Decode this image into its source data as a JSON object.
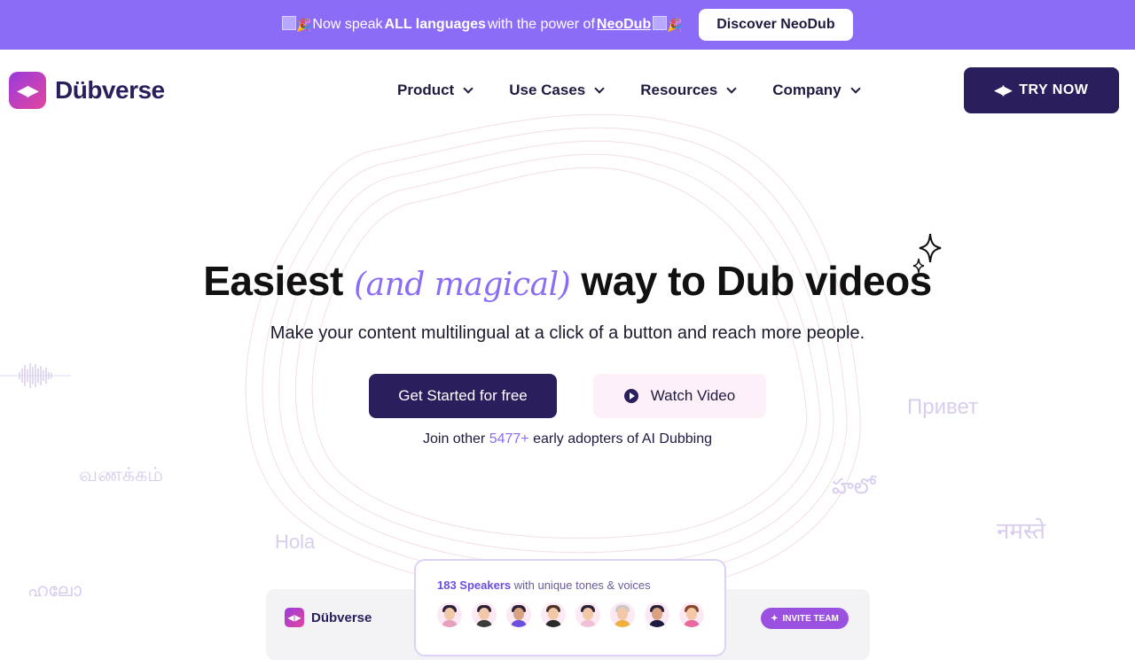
{
  "banner": {
    "prefix": "Now speak ",
    "highlight": "ALL languages",
    "middle": " with the power of ",
    "link": "NeoDub",
    "button": "Discover NeoDub"
  },
  "nav": {
    "logo_icon": "dubverse-logo-icon",
    "logo_mark": "◀|▶",
    "logo_text": "Dübverse",
    "items": [
      {
        "label": "Product"
      },
      {
        "label": "Use Cases"
      },
      {
        "label": "Resources"
      },
      {
        "label": "Company"
      }
    ],
    "try_now": "TRY NOW",
    "try_icon": "◀|▶"
  },
  "hero": {
    "title_start": "Easiest ",
    "title_magic": "(and magical)",
    "title_end": " way to Dub videos",
    "subtitle": "Make your content multilingual at a click of a button and reach more people.",
    "primary_cta": "Get Started for free",
    "secondary_cta": "Watch Video",
    "adopters_prefix": "Join other ",
    "adopters_count": "5477+",
    "adopters_suffix": " early adopters of AI Dubbing"
  },
  "greetings": {
    "russian": "Привет",
    "tamil": "வணக்கம்",
    "telugu": "హలో",
    "hindi": "नमस्ते",
    "spanish": "Hola",
    "malayalam": "ഹലോ"
  },
  "preview": {
    "logo_text": "Dübverse",
    "speakers_count": "183 Speakers",
    "speakers_text": " with unique tones & voices",
    "invite": "INVITE TEAM"
  },
  "colors": {
    "banner": "#8b6cf6",
    "primary": "#2b1e5c",
    "accent": "#8b6cf6"
  }
}
